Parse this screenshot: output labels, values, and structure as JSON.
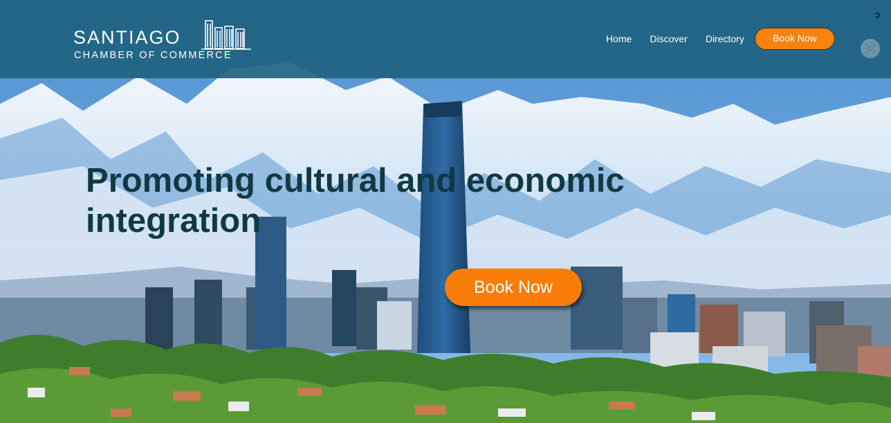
{
  "brand": {
    "name_main": "SANTIAGO",
    "name_sub": "CHAMBER OF COMMERCE"
  },
  "nav": {
    "items": [
      {
        "label": "Home"
      },
      {
        "label": "Discover"
      },
      {
        "label": "Directory"
      }
    ],
    "cta_label": "Book Now"
  },
  "hero": {
    "headline": "Promoting cultural and economic integration",
    "cta_label": "Book Now"
  },
  "colors": {
    "header_bg": "#206280",
    "accent_orange": "#f7820e",
    "headline_text": "#0f3a44"
  },
  "icons": {
    "loading": "loading-icon",
    "screenshot": "screenshot-icon",
    "logo_building": "building-icon"
  }
}
